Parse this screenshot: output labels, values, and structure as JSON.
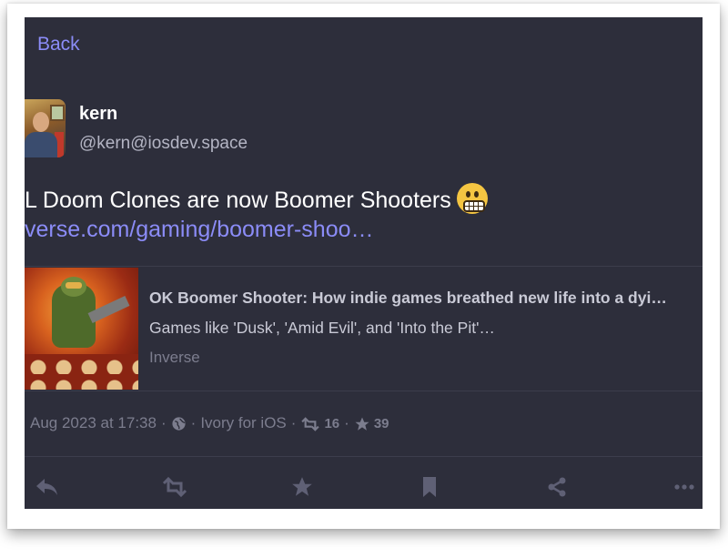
{
  "nav": {
    "back_label": "Back"
  },
  "author": {
    "display_name": "kern",
    "handle": "@kern@iosdev.space"
  },
  "post": {
    "text": "L Doom Clones are now Boomer Shooters",
    "link_text": "verse.com/gaming/boomer-shoo…",
    "emoji": "grimacing-face"
  },
  "link_card": {
    "title": "OK Boomer Shooter: How indie games breathed new life into a dyi…",
    "description": "Games like 'Dusk', 'Amid Evil', and 'Into the Pit'…",
    "source": "Inverse"
  },
  "meta": {
    "date": "Aug 2023 at 17:38",
    "separator": "·",
    "client": "Ivory for iOS",
    "boost_count": "16",
    "favorite_count": "39"
  },
  "actions": [
    "reply-icon",
    "boost-icon",
    "favorite-icon",
    "bookmark-icon",
    "share-icon",
    "more-icon"
  ],
  "colors": {
    "background": "#2d2e3b",
    "accent": "#8b8cf7",
    "muted": "#7c7d8e",
    "text": "#ffffff"
  }
}
